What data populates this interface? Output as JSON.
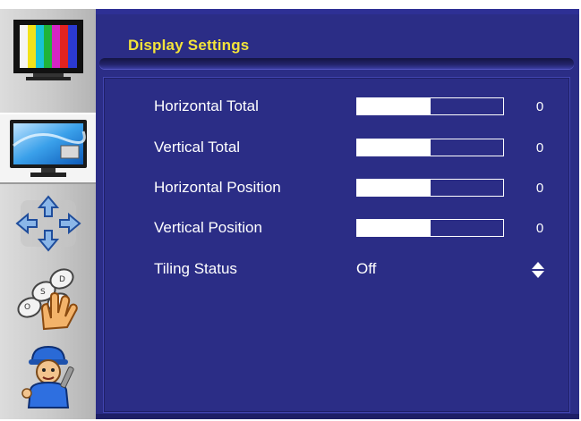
{
  "header": {
    "title": "Display Settings"
  },
  "sidebar": {
    "items": [
      {
        "icon": "color-bars-icon"
      },
      {
        "icon": "monitor-icon"
      },
      {
        "icon": "arrows-position-icon"
      },
      {
        "icon": "keypad-hand-icon"
      },
      {
        "icon": "technician-icon"
      }
    ]
  },
  "settings": [
    {
      "label": "Horizontal Total",
      "value": "0",
      "level": 0.5
    },
    {
      "label": "Vertical Total",
      "value": "0",
      "level": 0.5
    },
    {
      "label": "Horizontal Position",
      "value": "0",
      "level": 0.5
    },
    {
      "label": "Vertical Position",
      "value": "0",
      "level": 0.5
    }
  ],
  "tiling": {
    "label": "Tiling Status",
    "value": "Off"
  },
  "colors": {
    "panel": "#2b2d86",
    "title": "#f3e33a",
    "text": "#ffffff"
  }
}
